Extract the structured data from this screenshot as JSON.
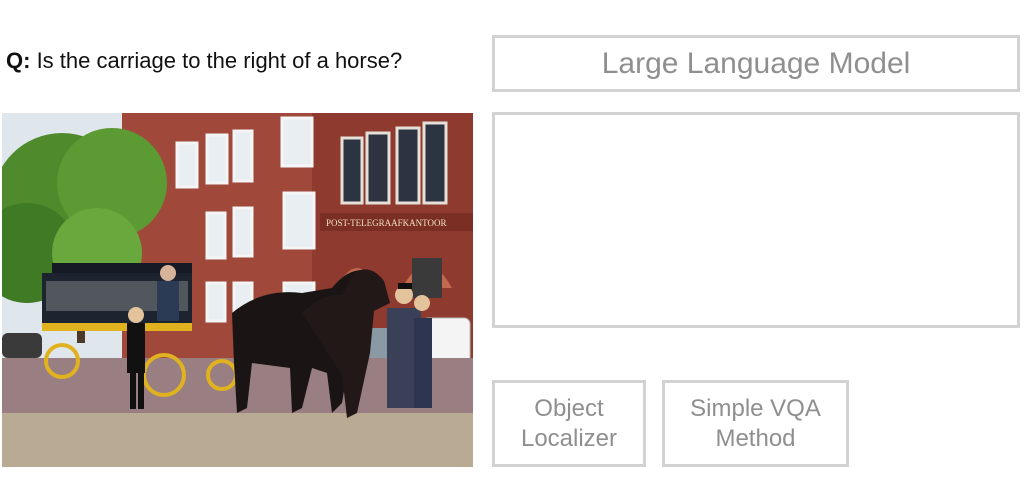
{
  "question": {
    "prefix": "Q:",
    "text": " Is the carriage to the right of a horse?"
  },
  "modules": {
    "llm_label": "Large Language Model",
    "object_localizer_label": "Object\nLocalizer",
    "simple_vqa_label": "Simple VQA\nMethod"
  },
  "photo": {
    "sign_text": "POST-TELEGRAAFKANTOOR"
  },
  "colors": {
    "box_border": "#d2d2d2",
    "box_text": "#8f8f8f"
  }
}
